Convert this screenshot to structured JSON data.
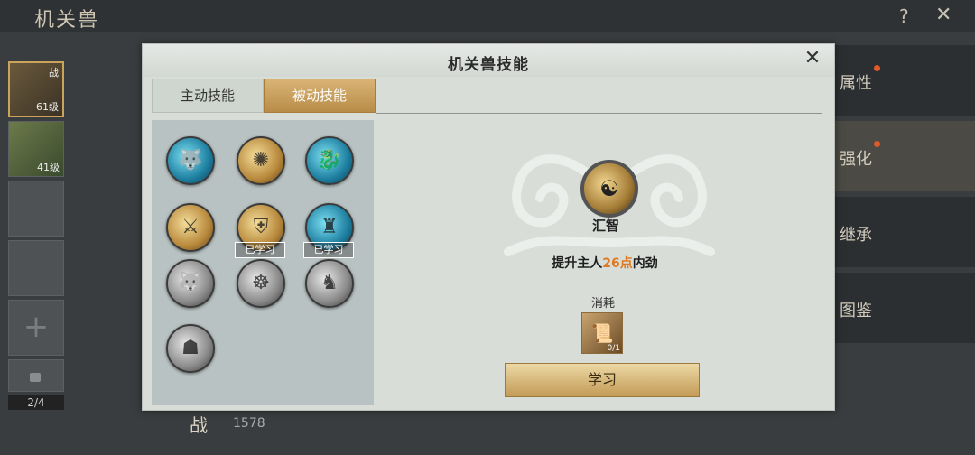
{
  "background": {
    "title": "机关兽",
    "help_icon": "?",
    "close_icon": "✕",
    "slots": [
      {
        "tag": "战",
        "level": "61级"
      },
      {
        "tag": "",
        "level": "41级"
      }
    ],
    "counter": "2/4",
    "power_label": "战",
    "power_value": "1578",
    "right_tabs": [
      "属性",
      "强化",
      "继承",
      "图鉴"
    ]
  },
  "dialog": {
    "title": "机关兽技能",
    "tabs": [
      "主动技能",
      "被动技能"
    ],
    "active_tab": 1,
    "learned_label": "已学习",
    "skills": [
      {
        "style": "blue",
        "icon": "beast-icon",
        "learned": false
      },
      {
        "style": "gold",
        "icon": "burst-icon",
        "learned": false
      },
      {
        "style": "blue",
        "icon": "dragon-icon",
        "learned": false
      },
      {
        "style": "gold",
        "icon": "armor-icon",
        "learned": false
      },
      {
        "style": "gold",
        "icon": "warrior-icon",
        "learned": true
      },
      {
        "style": "blue",
        "icon": "tower-icon",
        "learned": true
      },
      {
        "style": "gray",
        "icon": "beast-icon",
        "learned": false
      },
      {
        "style": "gray",
        "icon": "monk-icon",
        "learned": false
      },
      {
        "style": "gray",
        "icon": "rider-icon",
        "learned": false
      },
      {
        "style": "gray",
        "icon": "shadow-icon",
        "learned": false
      }
    ],
    "selected": {
      "name": "汇智",
      "desc_prefix": "提升主人",
      "desc_value": "26点",
      "desc_suffix": "内劲",
      "cost_label": "消耗",
      "cost_count": "0/1",
      "learn_button": "学习"
    },
    "accent": "#e07a22"
  }
}
